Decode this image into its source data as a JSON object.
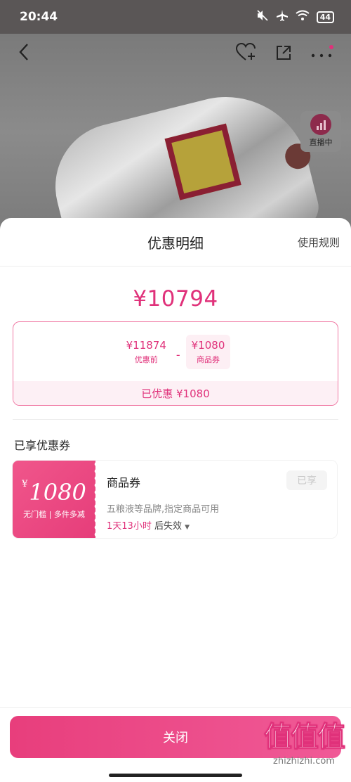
{
  "status_bar": {
    "time": "20:44",
    "battery": "44"
  },
  "product_page": {
    "live_label": "直播中"
  },
  "sheet": {
    "title": "优惠明细",
    "rules_link": "使用规则",
    "final_price": "¥10794",
    "calculation": {
      "original_amount": "¥11874",
      "original_label": "优惠前",
      "minus": "-",
      "coupon_amount": "¥1080",
      "coupon_label": "商品券",
      "saved_text": "已优惠 ¥1080"
    },
    "section_title": "已享优惠券",
    "coupon": {
      "currency": "¥",
      "amount": "1080",
      "desc": "无门槛 | 多件多减",
      "name": "商品券",
      "status": "已享",
      "scope": "五粮液等品牌,指定商品可用",
      "expire_highlight": "1天13小时",
      "expire_suffix": "后失效"
    },
    "close_button": "关闭"
  },
  "watermark": {
    "big": "值值值",
    "small": "zhizhizhi.com"
  },
  "colors": {
    "accent": "#e0317a",
    "button_gradient_start": "#e83e7c",
    "button_gradient_end": "#f05a97"
  }
}
